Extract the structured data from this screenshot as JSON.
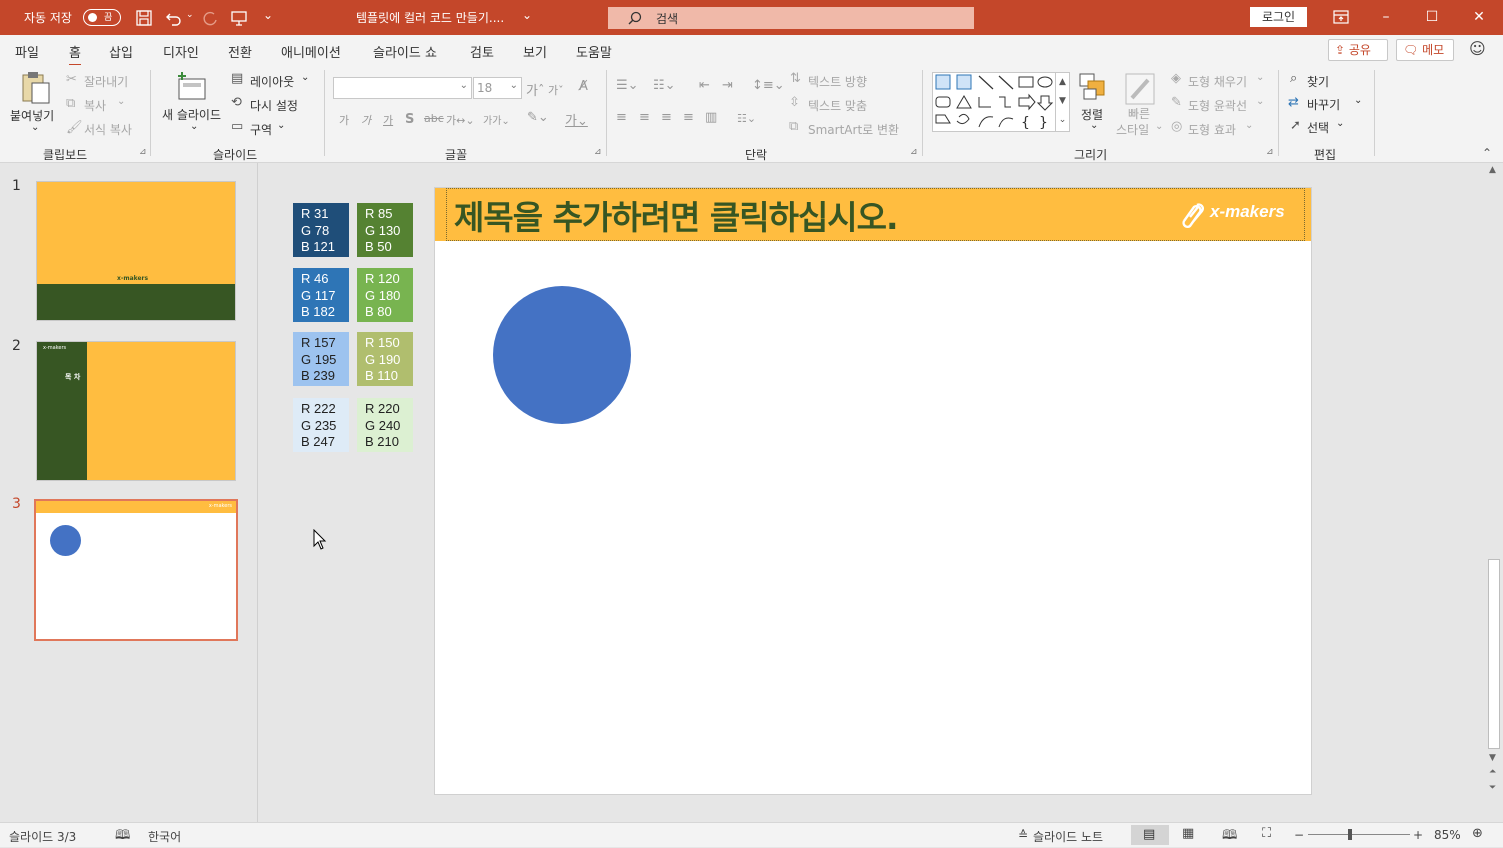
{
  "titlebar": {
    "autosave_label": "자동 저장",
    "autosave_state": "끔",
    "doc_title": "템플릿에 컬러 코드 만들기....",
    "search_placeholder": "검색",
    "login_label": "로그인",
    "bg_color": "#c4472a"
  },
  "menu": {
    "tabs": [
      "파일",
      "홈",
      "삽입",
      "디자인",
      "전환",
      "애니메이션",
      "슬라이드 쇼",
      "검토",
      "보기",
      "도움말"
    ],
    "active": "홈",
    "share_label": "공유",
    "memo_label": "메모"
  },
  "ribbon": {
    "clipboard": {
      "paste": "붙여넣기",
      "cut": "잘라내기",
      "copy": "복사",
      "format_painter": "서식 복사",
      "group": "클립보드"
    },
    "slides": {
      "new_slide": "새 슬라이드",
      "layout": "레이아웃",
      "reset": "다시 설정",
      "section": "구역",
      "group": "슬라이드"
    },
    "font": {
      "font_name": "",
      "font_size": "18",
      "group": "글꼴"
    },
    "paragraph": {
      "text_direction": "텍스트 방향",
      "align_text": "텍스트 맞춤",
      "smartart": "SmartArt로 변환",
      "group": "단락"
    },
    "drawing": {
      "arrange": "정렬",
      "quick_styles_1": "빠른",
      "quick_styles_2": "스타일",
      "shape_fill": "도형 채우기",
      "shape_outline": "도형 윤곽선",
      "shape_effects": "도형 효과",
      "group": "그리기"
    },
    "editing": {
      "find": "찾기",
      "replace": "바꾸기",
      "select": "선택",
      "group": "편집"
    }
  },
  "thumbnails": [
    {
      "num": "1",
      "logo": "x-makers"
    },
    {
      "num": "2",
      "logo": "x-makers",
      "toc": "목 차"
    },
    {
      "num": "3",
      "logo": "x-makers",
      "selected": true
    }
  ],
  "swatches": [
    {
      "r": "R 31",
      "g": "G 78",
      "b": "B 121",
      "color": "#1f4e79",
      "text_color": "#ffffff"
    },
    {
      "r": "R 85",
      "g": "G 130",
      "b": "B 50",
      "color": "#558232",
      "text_color": "#ffffff"
    },
    {
      "r": "R 46",
      "g": "G 117",
      "b": "B 182",
      "color": "#2e75b6",
      "text_color": "#ffffff"
    },
    {
      "r": "R 120",
      "g": "G 180",
      "b": "B 80",
      "color": "#78b450",
      "text_color": "#ffffff"
    },
    {
      "r": "R 157",
      "g": "G 195",
      "b": "B 239",
      "color": "#9dc3ef",
      "text_color": "#222222"
    },
    {
      "r": "R 150",
      "g": "G 190",
      "b": "B 110",
      "color": "#b0be6e",
      "text_color": "#ffffff"
    },
    {
      "r": "R 222",
      "g": "G 235",
      "b": "B 247",
      "color": "#deebf7",
      "text_color": "#222222"
    },
    {
      "r": "R 220",
      "g": "G 240",
      "b": "B 210",
      "color": "#dcf0d2",
      "text_color": "#222222"
    }
  ],
  "slide": {
    "title": "제목을 추가하려면 클릭하십시오.",
    "logo": "x-makers",
    "header_color": "#ffbd40",
    "title_color": "#375623",
    "circle_color": "#4472c4"
  },
  "status": {
    "slide_count": "슬라이드 3/3",
    "language": "한국어",
    "notes": "슬라이드 노트",
    "zoom": "85%",
    "zoom_minus": "−",
    "zoom_plus": "+"
  }
}
